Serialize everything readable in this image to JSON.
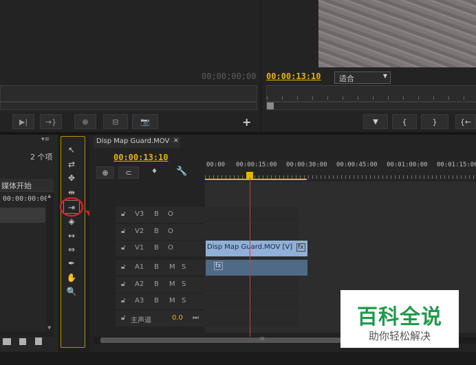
{
  "source_monitor": {
    "timecode": "00;00;00;00",
    "buttons": [
      "▶|",
      "→}",
      "⊕",
      "⊟",
      "📷"
    ],
    "add_label": "+"
  },
  "program_monitor": {
    "timecode": "00:00:13:10",
    "fit_option": "适合",
    "buttons": [
      "▼",
      "{",
      "}",
      "{←"
    ]
  },
  "project_panel": {
    "item_count": "2 个项",
    "column_header": "媒体开始",
    "row_value": "00:00:00:00"
  },
  "timeline": {
    "tab_label": "Disp Map Guard.MOV",
    "close_label": "×",
    "timecode": "00:00:13:10",
    "ruler_ticks": [
      "00:00",
      "00:00:15:00",
      "00:00:30:00",
      "00:00:45:00",
      "00:01:00:00",
      "00:01:15:00"
    ],
    "tracks": [
      {
        "name": "V3",
        "icons": [
          "B",
          "O"
        ]
      },
      {
        "name": "V2",
        "icons": [
          "B",
          "O"
        ]
      },
      {
        "name": "V1",
        "icons": [
          "B",
          "O"
        ]
      },
      {
        "name": "A1",
        "icons": [
          "B",
          "M",
          "S"
        ]
      },
      {
        "name": "A2",
        "icons": [
          "B",
          "M",
          "S"
        ]
      },
      {
        "name": "A3",
        "icons": [
          "B",
          "M",
          "S"
        ]
      }
    ],
    "master_label": "主声道",
    "master_value": "0.0",
    "video_clip_label": "Disp Map Guard.MOV [V]",
    "fx_label": "fx",
    "scroll_label": "III"
  },
  "watermark": {
    "title": "百科全说",
    "subtitle": "助你轻松解决"
  },
  "colors": {
    "accent_yellow": "#e7b400",
    "playhead_red": "#d23a3a",
    "video_clip": "#8fb0d8",
    "audio_clip": "#4f6a86",
    "annotation_red": "#d92020",
    "watermark_green": "#1f9a4b"
  }
}
